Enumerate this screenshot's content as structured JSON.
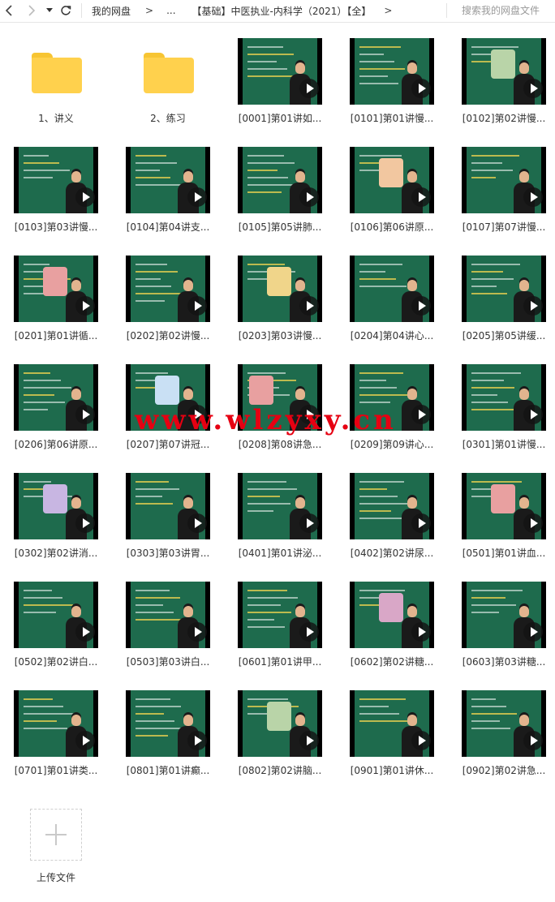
{
  "topbar": {
    "back_icon": "chevron-left-icon",
    "forward_icon": "chevron-right-icon",
    "dropdown_icon": "caret-down-icon",
    "refresh_icon": "refresh-icon",
    "breadcrumb": [
      "我的网盘",
      ">",
      "...",
      "【基础】中医执业-内科学（2021）【全】",
      ">"
    ],
    "search_placeholder": "搜索我的网盘文件"
  },
  "items": [
    {
      "type": "folder",
      "name": "1、讲义"
    },
    {
      "type": "folder",
      "name": "2、练习"
    },
    {
      "type": "video",
      "name": "[0001]第01讲如..."
    },
    {
      "type": "video",
      "name": "[0101]第01讲慢..."
    },
    {
      "type": "video",
      "name": "[0102]第02讲慢..."
    },
    {
      "type": "video",
      "name": "[0103]第03讲慢..."
    },
    {
      "type": "video",
      "name": "[0104]第04讲支..."
    },
    {
      "type": "video",
      "name": "[0105]第05讲肺..."
    },
    {
      "type": "video",
      "name": "[0106]第06讲原..."
    },
    {
      "type": "video",
      "name": "[0107]第07讲慢..."
    },
    {
      "type": "video",
      "name": "[0201]第01讲循..."
    },
    {
      "type": "video",
      "name": "[0202]第02讲慢..."
    },
    {
      "type": "video",
      "name": "[0203]第03讲慢..."
    },
    {
      "type": "video",
      "name": "[0204]第04讲心..."
    },
    {
      "type": "video",
      "name": "[0205]第05讲缓..."
    },
    {
      "type": "video",
      "name": "[0206]第06讲原..."
    },
    {
      "type": "video",
      "name": "[0207]第07讲冠..."
    },
    {
      "type": "video",
      "name": "[0208]第08讲急..."
    },
    {
      "type": "video",
      "name": "[0209]第09讲心..."
    },
    {
      "type": "video",
      "name": "[0301]第01讲慢..."
    },
    {
      "type": "video",
      "name": "[0302]第02讲消..."
    },
    {
      "type": "video",
      "name": "[0303]第03讲胃..."
    },
    {
      "type": "video",
      "name": "[0401]第01讲泌..."
    },
    {
      "type": "video",
      "name": "[0402]第02讲尿..."
    },
    {
      "type": "video",
      "name": "[0501]第01讲血..."
    },
    {
      "type": "video",
      "name": "[0502]第02讲白..."
    },
    {
      "type": "video",
      "name": "[0503]第03讲白..."
    },
    {
      "type": "video",
      "name": "[0601]第01讲甲..."
    },
    {
      "type": "video",
      "name": "[0602]第02讲糖..."
    },
    {
      "type": "video",
      "name": "[0603]第03讲糖..."
    },
    {
      "type": "video",
      "name": "[0701]第01讲类..."
    },
    {
      "type": "video",
      "name": "[0801]第01讲癫..."
    },
    {
      "type": "video",
      "name": "[0802]第02讲脑..."
    },
    {
      "type": "video",
      "name": "[0901]第01讲休..."
    },
    {
      "type": "video",
      "name": "[0902]第02讲急..."
    }
  ],
  "upload": {
    "label": "上传文件",
    "icon": "plus-icon"
  },
  "watermark": "www.wlzyxy.cn",
  "colors": {
    "folder": "#ffd14d",
    "board": "#1e6b4d",
    "watermark": "#e60012"
  }
}
